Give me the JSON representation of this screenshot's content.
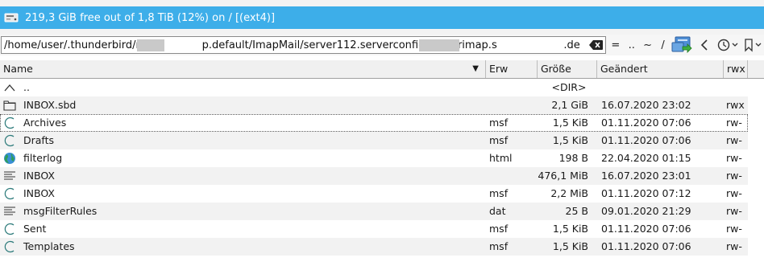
{
  "drivebar": {
    "label": "219,3 GiB free out of 1,8 TiB (12%) on / [(ext4)]",
    "icon": "drive-icon"
  },
  "path": {
    "value": "/home/user/.thunderbird/nx5       p.default/ImapMail/server112.serverconfig.centerimap.s          .de",
    "clear_icon": "backspace-icon"
  },
  "nav": {
    "eq": "=",
    "up": "..",
    "home": "~",
    "root": "/"
  },
  "columns": {
    "name": "Name",
    "ext": "Erw",
    "size": "Größe",
    "date": "Geändert",
    "attr": "rwx"
  },
  "rows": [
    {
      "icon": "parent-dir-icon",
      "name": "..",
      "ext": "",
      "size": "<DIR>",
      "date": "",
      "attr": ""
    },
    {
      "icon": "folder-icon",
      "name": "INBOX.sbd",
      "ext": "",
      "size": "2,1 GiB",
      "date": "16.07.2020 23:02",
      "attr": "rwx"
    },
    {
      "icon": "generic-file-icon",
      "name": "Archives",
      "ext": "msf",
      "size": "1,5 KiB",
      "date": "01.11.2020 07:06",
      "attr": "rw-"
    },
    {
      "icon": "generic-file-icon",
      "name": "Drafts",
      "ext": "msf",
      "size": "1,5 KiB",
      "date": "01.11.2020 07:06",
      "attr": "rw-"
    },
    {
      "icon": "globe-icon",
      "name": "filterlog",
      "ext": "html",
      "size": "198 B",
      "date": "22.04.2020 01:15",
      "attr": "rw-"
    },
    {
      "icon": "text-file-icon",
      "name": "INBOX",
      "ext": "",
      "size": "476,1 MiB",
      "date": "16.07.2020 23:01",
      "attr": "rw-"
    },
    {
      "icon": "generic-file-icon",
      "name": "INBOX",
      "ext": "msf",
      "size": "2,2 MiB",
      "date": "01.11.2020 07:12",
      "attr": "rw-"
    },
    {
      "icon": "text-file-icon",
      "name": "msgFilterRules",
      "ext": "dat",
      "size": "25 B",
      "date": "09.01.2020 21:29",
      "attr": "rw-"
    },
    {
      "icon": "generic-file-icon",
      "name": "Sent",
      "ext": "msf",
      "size": "1,5 KiB",
      "date": "01.11.2020 07:06",
      "attr": "rw-"
    },
    {
      "icon": "generic-file-icon",
      "name": "Templates",
      "ext": "msf",
      "size": "1,5 KiB",
      "date": "01.11.2020 07:06",
      "attr": "rw-"
    }
  ],
  "colors": {
    "drivebar_bg": "#3daee9",
    "alt_row": "#f2f2f2",
    "globe": "#2e9e5a"
  }
}
